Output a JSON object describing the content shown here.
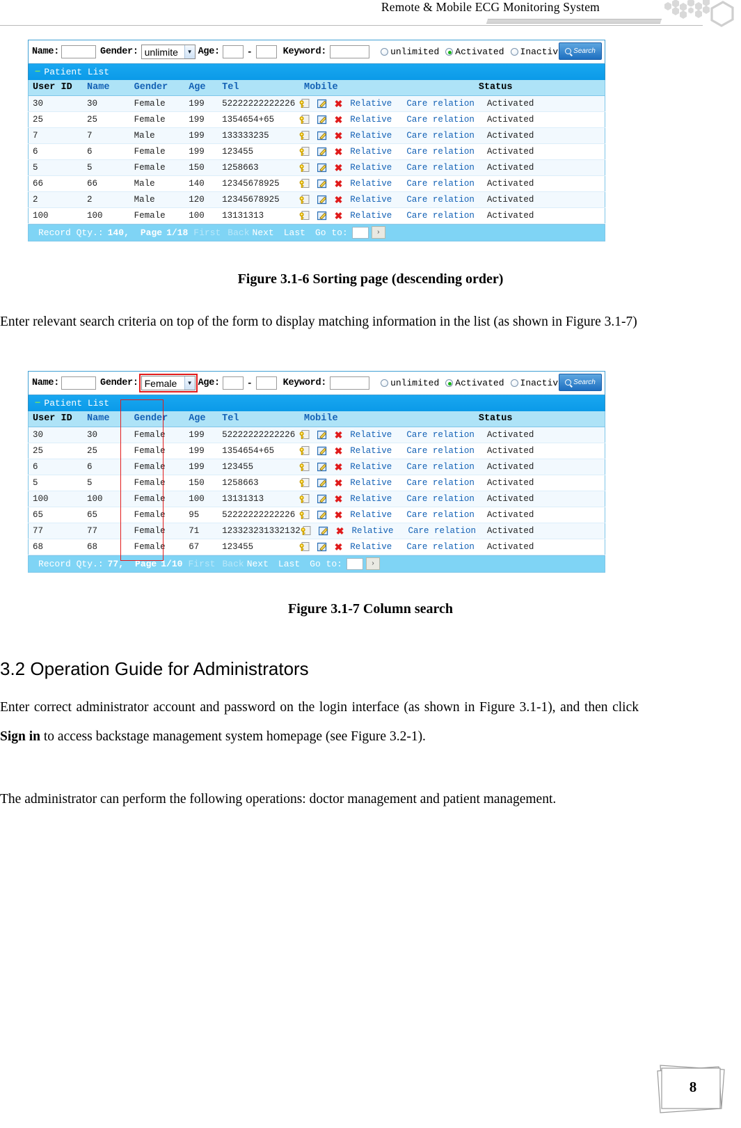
{
  "header": {
    "title": "Remote & Mobile ECG Monitoring System",
    "logo_icon": "hexagon-honeycomb-logo"
  },
  "screenshot1": {
    "search": {
      "name_label": "Name:",
      "name_value": "",
      "gender_label": "Gender:",
      "gender_value": "unlimite",
      "age_label": "Age:",
      "age_from": "",
      "age_to": "",
      "age_separator": "-",
      "keyword_label": "Keyword:",
      "keyword_value": "",
      "radios": [
        {
          "label": "unlimited",
          "checked": false
        },
        {
          "label": "Activated",
          "checked": true
        },
        {
          "label": "Inactive",
          "checked": false
        }
      ],
      "search_button": "Search"
    },
    "panel_title": "Patient List",
    "columns": [
      "User ID",
      "Name",
      "Gender",
      "Age",
      "Tel",
      "Mobile",
      "",
      "Status"
    ],
    "row_actions": {
      "key_icon": "key-password-icon",
      "edit_icon": "edit-pencil-icon",
      "delete_icon": "delete-x-icon",
      "relative_link": "Relative",
      "care_relation_link": "Care relation"
    },
    "rows": [
      {
        "user_id": "30",
        "name": "30",
        "gender": "Female",
        "age": "199",
        "mobile": "52222222222226",
        "status": "Activated"
      },
      {
        "user_id": "25",
        "name": "25",
        "gender": "Female",
        "age": "199",
        "mobile": "1354654+65",
        "status": "Activated"
      },
      {
        "user_id": "7",
        "name": "7",
        "gender": "Male",
        "age": "199",
        "mobile": "133333235",
        "status": "Activated"
      },
      {
        "user_id": "6",
        "name": "6",
        "gender": "Female",
        "age": "199",
        "mobile": "123455",
        "status": "Activated"
      },
      {
        "user_id": "5",
        "name": "5",
        "gender": "Female",
        "age": "150",
        "mobile": "1258663",
        "status": "Activated"
      },
      {
        "user_id": "66",
        "name": "66",
        "gender": "Male",
        "age": "140",
        "mobile": "12345678925",
        "status": "Activated"
      },
      {
        "user_id": "2",
        "name": "2",
        "gender": "Male",
        "age": "120",
        "mobile": "12345678925",
        "status": "Activated"
      },
      {
        "user_id": "100",
        "name": "100",
        "gender": "Female",
        "age": "100",
        "mobile": "13131313",
        "status": "Activated"
      }
    ],
    "pager": {
      "record_label": "Record Qty.:",
      "record_count": "140,",
      "page_label": "Page",
      "page_value": "1/18",
      "first": "First",
      "back": "Back",
      "next": "Next",
      "last": "Last",
      "goto_label": "Go to:",
      "goto_value": "",
      "go_button": "›"
    }
  },
  "caption1": "Figure 3.1-6 Sorting page (descending order)",
  "para1": "Enter relevant search criteria on top of the form to display matching information in the list (as shown in Figure 3.1-7)",
  "screenshot2": {
    "search": {
      "name_label": "Name:",
      "name_value": "",
      "gender_label": "Gender:",
      "gender_value": "Female",
      "age_label": "Age:",
      "age_from": "",
      "age_to": "",
      "age_separator": "-",
      "keyword_label": "Keyword:",
      "keyword_value": "",
      "radios": [
        {
          "label": "unlimited",
          "checked": false
        },
        {
          "label": "Activated",
          "checked": true
        },
        {
          "label": "Inactive",
          "checked": false
        }
      ],
      "search_button": "Search"
    },
    "panel_title": "Patient List",
    "columns": [
      "User ID",
      "Name",
      "Gender",
      "Age",
      "Tel",
      "Mobile",
      "",
      "Status"
    ],
    "row_actions": {
      "key_icon": "key-password-icon",
      "edit_icon": "edit-pencil-icon",
      "delete_icon": "delete-x-icon",
      "relative_link": "Relative",
      "care_relation_link": "Care relation"
    },
    "rows": [
      {
        "user_id": "30",
        "name": "30",
        "gender": "Female",
        "age": "199",
        "mobile": "52222222222226",
        "status": "Activated"
      },
      {
        "user_id": "25",
        "name": "25",
        "gender": "Female",
        "age": "199",
        "mobile": "1354654+65",
        "status": "Activated"
      },
      {
        "user_id": "6",
        "name": "6",
        "gender": "Female",
        "age": "199",
        "mobile": "123455",
        "status": "Activated"
      },
      {
        "user_id": "5",
        "name": "5",
        "gender": "Female",
        "age": "150",
        "mobile": "1258663",
        "status": "Activated"
      },
      {
        "user_id": "100",
        "name": "100",
        "gender": "Female",
        "age": "100",
        "mobile": "13131313",
        "status": "Activated"
      },
      {
        "user_id": "65",
        "name": "65",
        "gender": "Female",
        "age": "95",
        "mobile": "52222222222226",
        "status": "Activated"
      },
      {
        "user_id": "77",
        "name": "77",
        "gender": "Female",
        "age": "71",
        "mobile": "123323231332132",
        "status": "Activated"
      },
      {
        "user_id": "68",
        "name": "68",
        "gender": "Female",
        "age": "67",
        "mobile": "123455",
        "status": "Activated"
      }
    ],
    "pager": {
      "record_label": "Record Qty.:",
      "record_count": "77,",
      "page_label": "Page",
      "page_value": "1/10",
      "first": "First",
      "back": "Back",
      "next": "Next",
      "last": "Last",
      "goto_label": "Go to:",
      "goto_value": "",
      "go_button": "›"
    },
    "highlight_color": "#e21b1b"
  },
  "caption2": "Figure 3.1-7 Column search",
  "section": {
    "number": "3.2",
    "title": "Operation Guide for Administrators"
  },
  "para2_a": "Enter correct administrator account and password on the login interface (as shown in Figure 3.1-1), and then click ",
  "para2_bold": "Sign in",
  "para2_b": " to access backstage management system homepage (see Figure 3.2-1).",
  "para3": "The administrator can perform the following operations: doctor management and patient management.",
  "page_number": "8"
}
